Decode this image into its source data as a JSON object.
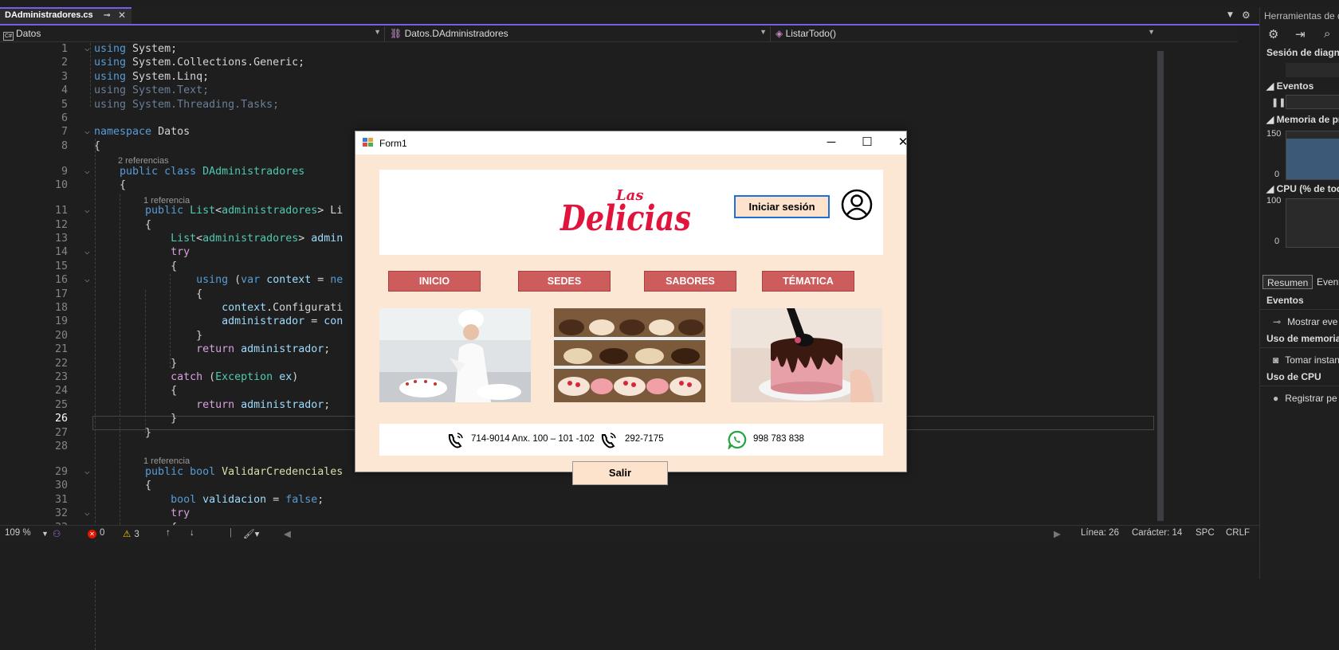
{
  "editor_tab": {
    "filename": "DAdministradores.cs",
    "pin_icon": "pin-icon",
    "close_icon": "close-icon"
  },
  "navbar": {
    "project": "Datos",
    "class": "Datos.DAdministradores",
    "member": "ListarTodo()"
  },
  "code": {
    "lines": [
      {
        "n": "1",
        "fold": "⌵",
        "html": "<span class='kw'>using</span> System;"
      },
      {
        "n": "2",
        "fold": "",
        "html": "<span class='kw'>using</span> System.Collections.Generic;"
      },
      {
        "n": "3",
        "fold": "",
        "html": "<span class='kw'>using</span> System.Linq;"
      },
      {
        "n": "4",
        "fold": "",
        "html": "<span class='dim'>using System.Text;</span>"
      },
      {
        "n": "5",
        "fold": "",
        "html": "<span class='dim'>using System.Threading.Tasks;</span>"
      },
      {
        "n": "6",
        "fold": "",
        "html": ""
      },
      {
        "n": "7",
        "fold": "⌵",
        "html": "<span class='kw'>namespace</span> Datos"
      },
      {
        "n": "8",
        "fold": "",
        "html": "{"
      },
      {
        "n": "9",
        "fold": "⌵",
        "html": "    <span class='kw'>public class</span> <span class='ty'>DAdministradores</span>"
      },
      {
        "n": "10",
        "fold": "",
        "html": "    {"
      },
      {
        "n": "11",
        "fold": "⌵",
        "html": "        <span class='kw'>public</span> <span class='ty'>List</span>&lt;<span class='ty'>administradores</span>&gt; Li"
      },
      {
        "n": "12",
        "fold": "",
        "html": "        {"
      },
      {
        "n": "13",
        "fold": "",
        "html": "            <span class='ty'>List</span>&lt;<span class='ty'>administradores</span>&gt; <span class='vr'>admin</span>"
      },
      {
        "n": "14",
        "fold": "⌵",
        "html": "            <span class='ctl'>try</span>"
      },
      {
        "n": "15",
        "fold": "",
        "html": "            {"
      },
      {
        "n": "16",
        "fold": "⌵",
        "html": "                <span class='kw'>using</span> (<span class='kw'>var</span> <span class='vr'>context</span> = <span class='kw'>ne</span>"
      },
      {
        "n": "17",
        "fold": "",
        "html": "                {"
      },
      {
        "n": "18",
        "fold": "",
        "html": "                    <span class='vr'>context</span>.Configurati"
      },
      {
        "n": "19",
        "fold": "",
        "html": "                    <span class='vr'>administrador</span> = <span class='vr'>con</span>"
      },
      {
        "n": "20",
        "fold": "",
        "html": "                }"
      },
      {
        "n": "21",
        "fold": "",
        "html": "                <span class='ctl'>return</span> <span class='vr'>administrador</span>;"
      },
      {
        "n": "22",
        "fold": "",
        "html": "            }"
      },
      {
        "n": "23",
        "fold": "",
        "html": "            <span class='ctl'>catch</span> (<span class='gn'>Exception</span> <span class='vr'>ex</span>)"
      },
      {
        "n": "24",
        "fold": "",
        "html": "            {"
      },
      {
        "n": "25",
        "fold": "",
        "html": "                <span class='ctl'>return</span> <span class='vr'>administrador</span>;"
      },
      {
        "n": "26",
        "fold": "",
        "html": "            }"
      },
      {
        "n": "27",
        "fold": "",
        "html": "        }"
      },
      {
        "n": "28",
        "fold": "",
        "html": ""
      },
      {
        "n": "29",
        "fold": "⌵",
        "html": "        <span class='kw'>public bool</span> <span class='fn'>ValidarCredenciales</span>"
      },
      {
        "n": "30",
        "fold": "",
        "html": "        {"
      },
      {
        "n": "31",
        "fold": "",
        "html": "            <span class='kw'>bool</span> <span class='vr'>validacion</span> = <span class='kw'>false</span>;"
      },
      {
        "n": "32",
        "fold": "⌵",
        "html": "            <span class='ctl'>try</span>"
      },
      {
        "n": "33",
        "fold": "",
        "html": "            {"
      }
    ],
    "refs": [
      {
        "text": "2 referencias",
        "after": "8"
      },
      {
        "text": "1 referencia",
        "after": "10"
      },
      {
        "text": "1 referencia",
        "after": "28"
      }
    ],
    "current_line": "26"
  },
  "status": {
    "zoom": "109 %",
    "errors": "0",
    "warnings": "3",
    "line": "Línea: 26",
    "char": "Carácter: 14",
    "spc": "SPC",
    "crlf": "CRLF"
  },
  "diag_panel": {
    "title": "Herramientas de d",
    "session": "Sesión de diagno",
    "events": "Eventos",
    "memory": "Memoria de pro",
    "mem_max": "150",
    "mem_min": "0",
    "cpu": "CPU (% de todo",
    "cpu_max": "100",
    "cpu_min": "0",
    "tabs": [
      "Resumen",
      "Event"
    ],
    "rows": [
      {
        "label": "Eventos",
        "head": true
      },
      {
        "label": "Mostrar eve",
        "head": false,
        "icon": "events-icon"
      },
      {
        "label": "Uso de memoria",
        "head": true
      },
      {
        "label": "Tomar instan",
        "head": false,
        "icon": "camera-icon"
      },
      {
        "label": "Uso de CPU",
        "head": true
      },
      {
        "label": "Registrar pe",
        "head": false,
        "icon": "record-icon"
      }
    ]
  },
  "form": {
    "title": "Form1",
    "logo_small": "Las",
    "logo_big": "Delicias",
    "login_button": "Iniciar sesión",
    "menu": [
      "INICIO",
      "SEDES",
      "SABORES",
      "TÉMATICA"
    ],
    "phone1": "714-9014 Anx. 100 – 101 -102",
    "phone2": "292-7175",
    "whatsapp": "998 783 838",
    "exit_button": "Salir",
    "colors": {
      "background": "#fbe7d4",
      "menu": "#cd5c5c",
      "logo": "#e0143c"
    }
  }
}
